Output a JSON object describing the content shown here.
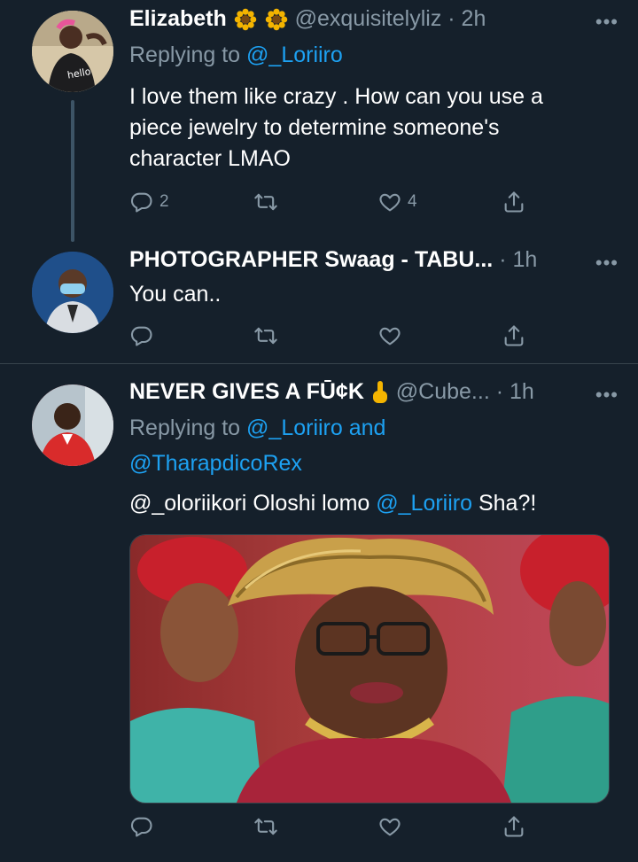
{
  "tweets": [
    {
      "display_name": "Elizabeth",
      "handle": "@exquisitelyliz",
      "time": "· 2h",
      "replying_prefix": "Replying to ",
      "replying_to": "@_Loriiro",
      "text_lines": [
        "I love them like crazy . How can you use a",
        "piece jewelry to determine someone's",
        "character LMAO"
      ],
      "reply_count": "2",
      "retweet_count": "",
      "like_count": "4"
    },
    {
      "display_name": "PHOTOGRAPHER Swaag - TABU...",
      "time": "· 1h",
      "text": "You can.."
    },
    {
      "display_name": "NEVER GIVES A FŪ¢K",
      "handle": "@Cube...",
      "time": "· 1h",
      "replying_prefix": "Replying to ",
      "replying_to_1": "@_Loriiro",
      "replying_and": " and",
      "replying_to_2": "@TharapdicoRex",
      "text_mention_1": "@_oloriikori",
      "text_middle": " Oloshi lomo ",
      "text_mention_2": "@_Loriiro",
      "text_end": " Sha?!"
    }
  ],
  "more_label": "•••",
  "icons": [
    "reply-icon",
    "retweet-icon",
    "like-icon",
    "share-icon",
    "more-icon",
    "sunflower-emoji",
    "raised-finger-emoji"
  ],
  "colors": {
    "background": "#15202b",
    "muted": "#8899a6",
    "link": "#1da1f2",
    "divider": "#38444d"
  }
}
